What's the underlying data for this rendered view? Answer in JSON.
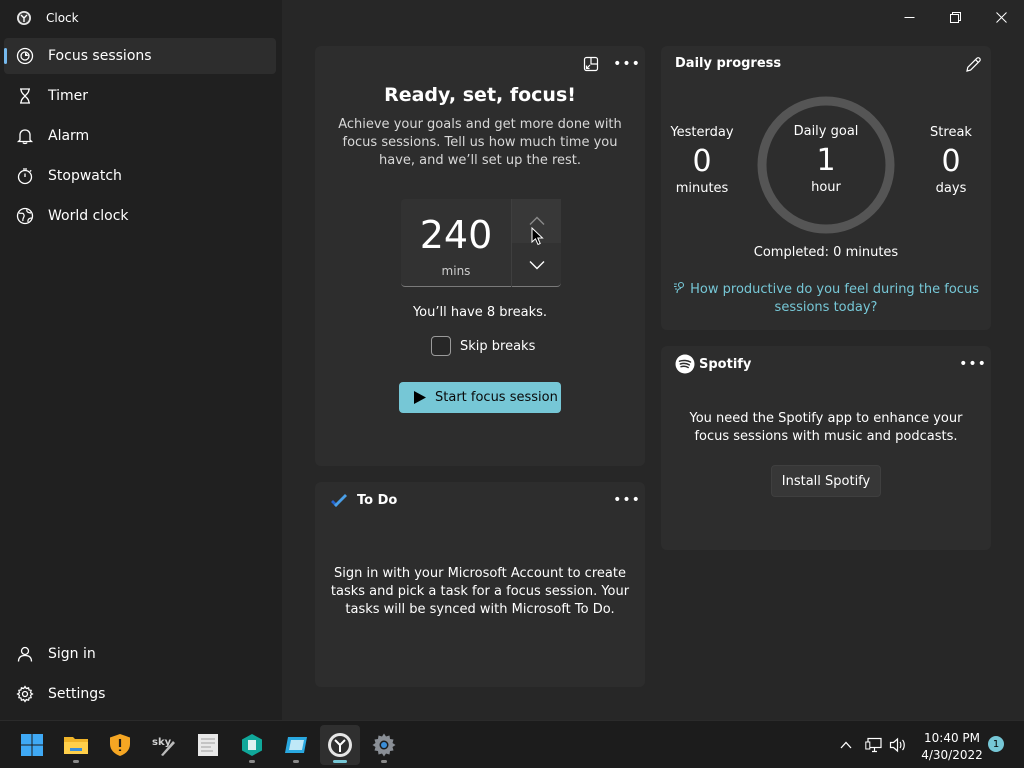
{
  "window": {
    "title": "Clock"
  },
  "nav": {
    "items": [
      {
        "label": "Focus sessions",
        "icon": "focus-icon",
        "active": true
      },
      {
        "label": "Timer",
        "icon": "hourglass-icon"
      },
      {
        "label": "Alarm",
        "icon": "bell-icon"
      },
      {
        "label": "Stopwatch",
        "icon": "stopwatch-icon"
      },
      {
        "label": "World clock",
        "icon": "globe-icon"
      }
    ],
    "bottom": [
      {
        "label": "Sign in",
        "icon": "person-icon"
      },
      {
        "label": "Settings",
        "icon": "gear-icon"
      }
    ]
  },
  "focus": {
    "title": "Ready, set, focus!",
    "description": "Achieve your goals and get more done with focus sessions. Tell us how much time you have, and we’ll set up the rest.",
    "minutes": "240",
    "unit": "mins",
    "breaks_text": "You’ll have 8 breaks.",
    "skip_label": "Skip breaks",
    "start_label": "Start focus session"
  },
  "todo": {
    "title": "To Do",
    "body": "Sign in with your Microsoft Account to create tasks and pick a task for a focus session. Your tasks will be synced with Microsoft To Do."
  },
  "progress": {
    "title": "Daily progress",
    "yesterday": {
      "label": "Yesterday",
      "value": "0",
      "unit": "minutes"
    },
    "goal": {
      "label": "Daily goal",
      "value": "1",
      "unit": "hour"
    },
    "streak": {
      "label": "Streak",
      "value": "0",
      "unit": "days"
    },
    "completed": "Completed: 0 minutes",
    "feedback_link": "How productive do you feel during the focus sessions today?"
  },
  "spotify": {
    "name": "Spotify",
    "body": "You need the Spotify app to enhance your focus sessions with music and podcasts.",
    "install_label": "Install Spotify"
  },
  "taskbar": {
    "time": "10:40 PM",
    "date": "4/30/2022",
    "notifications": "1"
  },
  "colors": {
    "accent": "#76c7d6",
    "nav_indicator": "#76b9ed",
    "card": "#2d2d2d",
    "background": "#202020"
  }
}
